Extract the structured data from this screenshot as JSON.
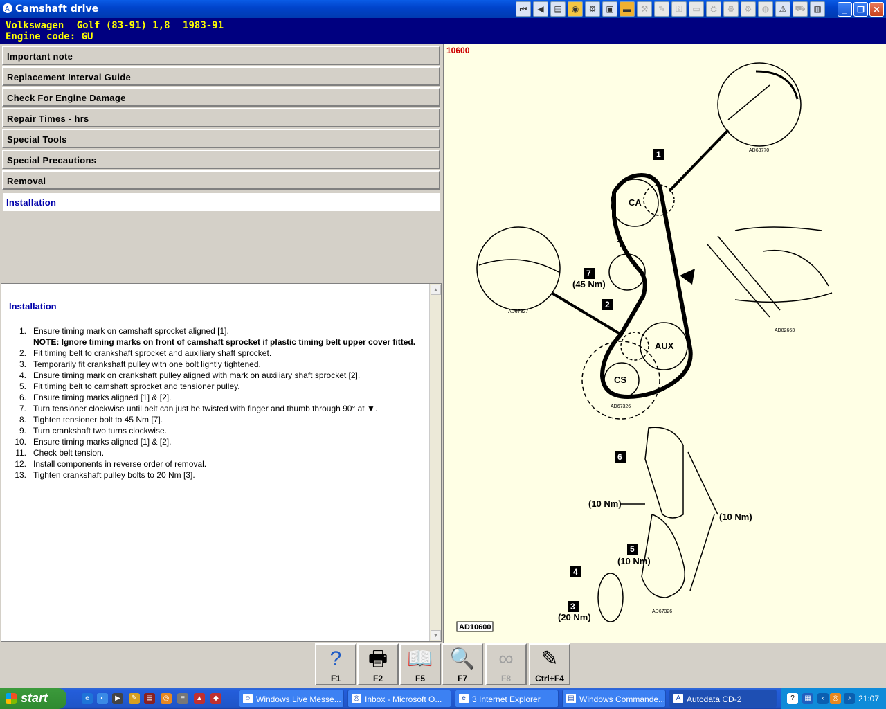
{
  "window": {
    "title": "Camshaft drive"
  },
  "toolbar": {
    "icons": [
      "first-icon",
      "prev-icon",
      "book-icon",
      "coin-icon",
      "gear-icon",
      "car-icon",
      "wrench-icon",
      "tools-icon",
      "oil-icon",
      "tool-icon",
      "belt-icon",
      "pump-icon",
      "gears-icon",
      "engine-icon",
      "warning-icon",
      "car2-icon",
      "doc-icon"
    ]
  },
  "vehicle": {
    "make": "Volkswagen",
    "model": "Golf (83-91) 1,8",
    "years": "1983-91",
    "engine_code": "Engine code: GU"
  },
  "nav": {
    "items": [
      {
        "label": "Important note"
      },
      {
        "label": "Replacement Interval Guide"
      },
      {
        "label": "Check For Engine Damage"
      },
      {
        "label": "Repair Times - hrs"
      },
      {
        "label": "Special Tools"
      },
      {
        "label": "Special Precautions"
      },
      {
        "label": "Removal"
      },
      {
        "label": "Installation"
      }
    ]
  },
  "content": {
    "heading": "Installation",
    "steps": [
      {
        "n": "1.",
        "text": "Ensure timing mark on camshaft sprocket aligned [1].",
        "note": "NOTE: Ignore timing marks on front of camshaft sprocket if plastic timing belt upper cover fitted."
      },
      {
        "n": "2.",
        "text": "Fit timing belt to crankshaft sprocket and auxiliary shaft sprocket."
      },
      {
        "n": "3.",
        "text": "Temporarily fit crankshaft pulley with one bolt lightly tightened."
      },
      {
        "n": "4.",
        "text": "Ensure timing mark on crankshaft pulley aligned with mark on auxiliary shaft sprocket [2]."
      },
      {
        "n": "5.",
        "text": "Fit timing belt to camshaft sprocket and tensioner pulley."
      },
      {
        "n": "6.",
        "text": "Ensure timing marks aligned [1] & [2]."
      },
      {
        "n": "7.",
        "text": "Turn tensioner clockwise until belt can just be twisted with finger and thumb through 90° at ▼."
      },
      {
        "n": "8.",
        "text": "Tighten tensioner bolt to 45 Nm [7]."
      },
      {
        "n": "9.",
        "text": "Turn crankshaft two turns clockwise."
      },
      {
        "n": "10.",
        "text": "Ensure timing marks aligned [1] & [2]."
      },
      {
        "n": "11.",
        "text": "Check belt tension."
      },
      {
        "n": "12.",
        "text": "Install components in reverse order of removal."
      },
      {
        "n": "13.",
        "text": "Tighten crankshaft pulley bolts to 20 Nm [3]."
      }
    ]
  },
  "diagram": {
    "code": "10600",
    "ref": "AD10600",
    "labels": {
      "ca": "CA",
      "t": "T",
      "aux": "AUX",
      "cs": "CS",
      "torque45": "(45 Nm)",
      "torque10a": "(10 Nm)",
      "torque10b": "(10 Nm)",
      "torque10c": "(10 Nm)",
      "torque20": "(20 Nm)",
      "fig1": "AD63770",
      "fig2": "AD67327",
      "fig3": "AD67326",
      "fig4": "AD82663",
      "fig5": "AD67326"
    },
    "callouts": [
      "1",
      "2",
      "3",
      "4",
      "5",
      "6",
      "7"
    ]
  },
  "function_keys": [
    {
      "label": "F1",
      "icon": "help-icon",
      "glyph": "?"
    },
    {
      "label": "F2",
      "icon": "print-icon",
      "glyph": "🖶"
    },
    {
      "label": "F5",
      "icon": "book-icon",
      "glyph": "📖"
    },
    {
      "label": "F7",
      "icon": "zoom-icon",
      "glyph": "🔍"
    },
    {
      "label": "F8",
      "icon": "belt-icon",
      "glyph": "∞"
    },
    {
      "label": "Ctrl+F4",
      "icon": "note-icon",
      "glyph": "✎"
    }
  ],
  "taskbar": {
    "start": "start",
    "tasks": [
      {
        "label": "Windows Live Messe..."
      },
      {
        "label": "Inbox - Microsoft O..."
      },
      {
        "label": "3 Internet Explorer"
      },
      {
        "label": "Windows Commande..."
      },
      {
        "label": "Autodata CD-2"
      }
    ],
    "clock": "21:07"
  }
}
